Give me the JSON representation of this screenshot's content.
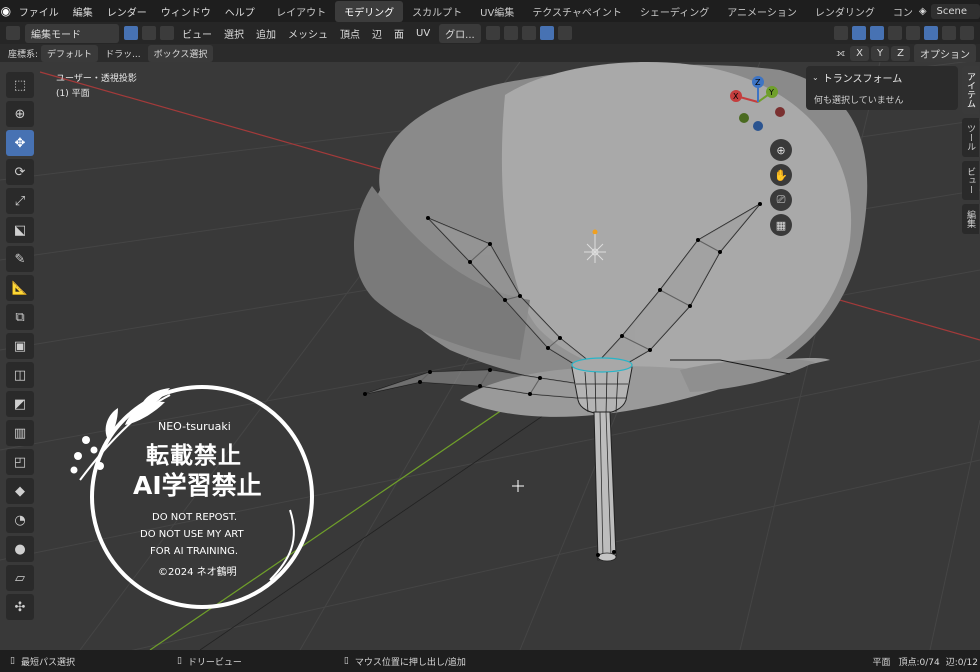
{
  "top_menu": [
    "ファイル",
    "編集",
    "レンダー",
    "ウィンドウ",
    "ヘルプ"
  ],
  "workspace_tabs": [
    "レイアウト",
    "モデリング",
    "スカルプト",
    "UV編集",
    "テクスチャペイント",
    "シェーディング",
    "アニメーション",
    "レンダリング",
    "コン"
  ],
  "active_workspace": "モデリング",
  "scene_name": "Scene",
  "header": {
    "mode": "編集モード",
    "menus": [
      "ビュー",
      "選択",
      "追加",
      "メッシュ",
      "頂点",
      "辺",
      "面",
      "UV"
    ],
    "transform_orientation": "グロ..."
  },
  "header3": {
    "coord_label": "座標系:",
    "coord_value": "デフォルト",
    "drag_label": "ドラッ...",
    "drag_value": "ボックス選択",
    "axes": [
      "X",
      "Y",
      "Z"
    ],
    "options": "オプション"
  },
  "viewport": {
    "view_name": "ユーザー・透視投影",
    "object_info": "(1) 平面"
  },
  "npanel": {
    "title": "トランスフォーム",
    "message": "何も選択していません"
  },
  "side_tabs": [
    "アイテム",
    "ツール",
    "ビュー",
    "編集"
  ],
  "gizmo": {
    "x": "X",
    "y": "Y",
    "z": "Z"
  },
  "watermark": {
    "author": "NEO-tsuruaki",
    "line1": "転載禁止",
    "line2": "AI学習禁止",
    "en1": "DO NOT REPOST.",
    "en2": "DO NOT USE MY ART",
    "en3": "FOR AI TRAINING.",
    "copyright": "©2024 ネオ鶴明"
  },
  "status": {
    "left": "最短パス選択",
    "middle": "ドリービュー",
    "right": "マウス位置に押し出し/追加",
    "object": "平面",
    "verts": "頂点:0/74",
    "edges": "辺:0/12"
  },
  "colors": {
    "accent": "#4772b3",
    "x_axis": "#c43d3d",
    "y_axis": "#6f9f2a",
    "z_axis": "#3d74c4"
  }
}
